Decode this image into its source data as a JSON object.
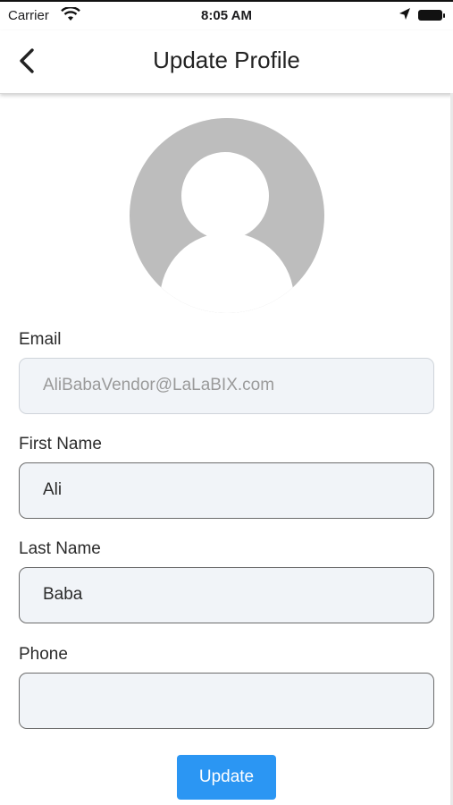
{
  "status_bar": {
    "carrier": "Carrier",
    "time": "8:05 AM"
  },
  "nav": {
    "title": "Update Profile",
    "back_icon": "chevron-left-icon"
  },
  "avatar": {
    "icon": "default-user-avatar-icon",
    "color": "#bdbdbd"
  },
  "form": {
    "email": {
      "label": "Email",
      "value": "AliBabaVendor@LaLaBIX.com",
      "disabled": true
    },
    "first_name": {
      "label": "First Name",
      "value": "Ali"
    },
    "last_name": {
      "label": "Last Name",
      "value": "Baba"
    },
    "phone": {
      "label": "Phone",
      "value": ""
    },
    "submit_label": "Update"
  },
  "colors": {
    "accent": "#2b96f3",
    "field_bg": "#f1f4f8"
  }
}
